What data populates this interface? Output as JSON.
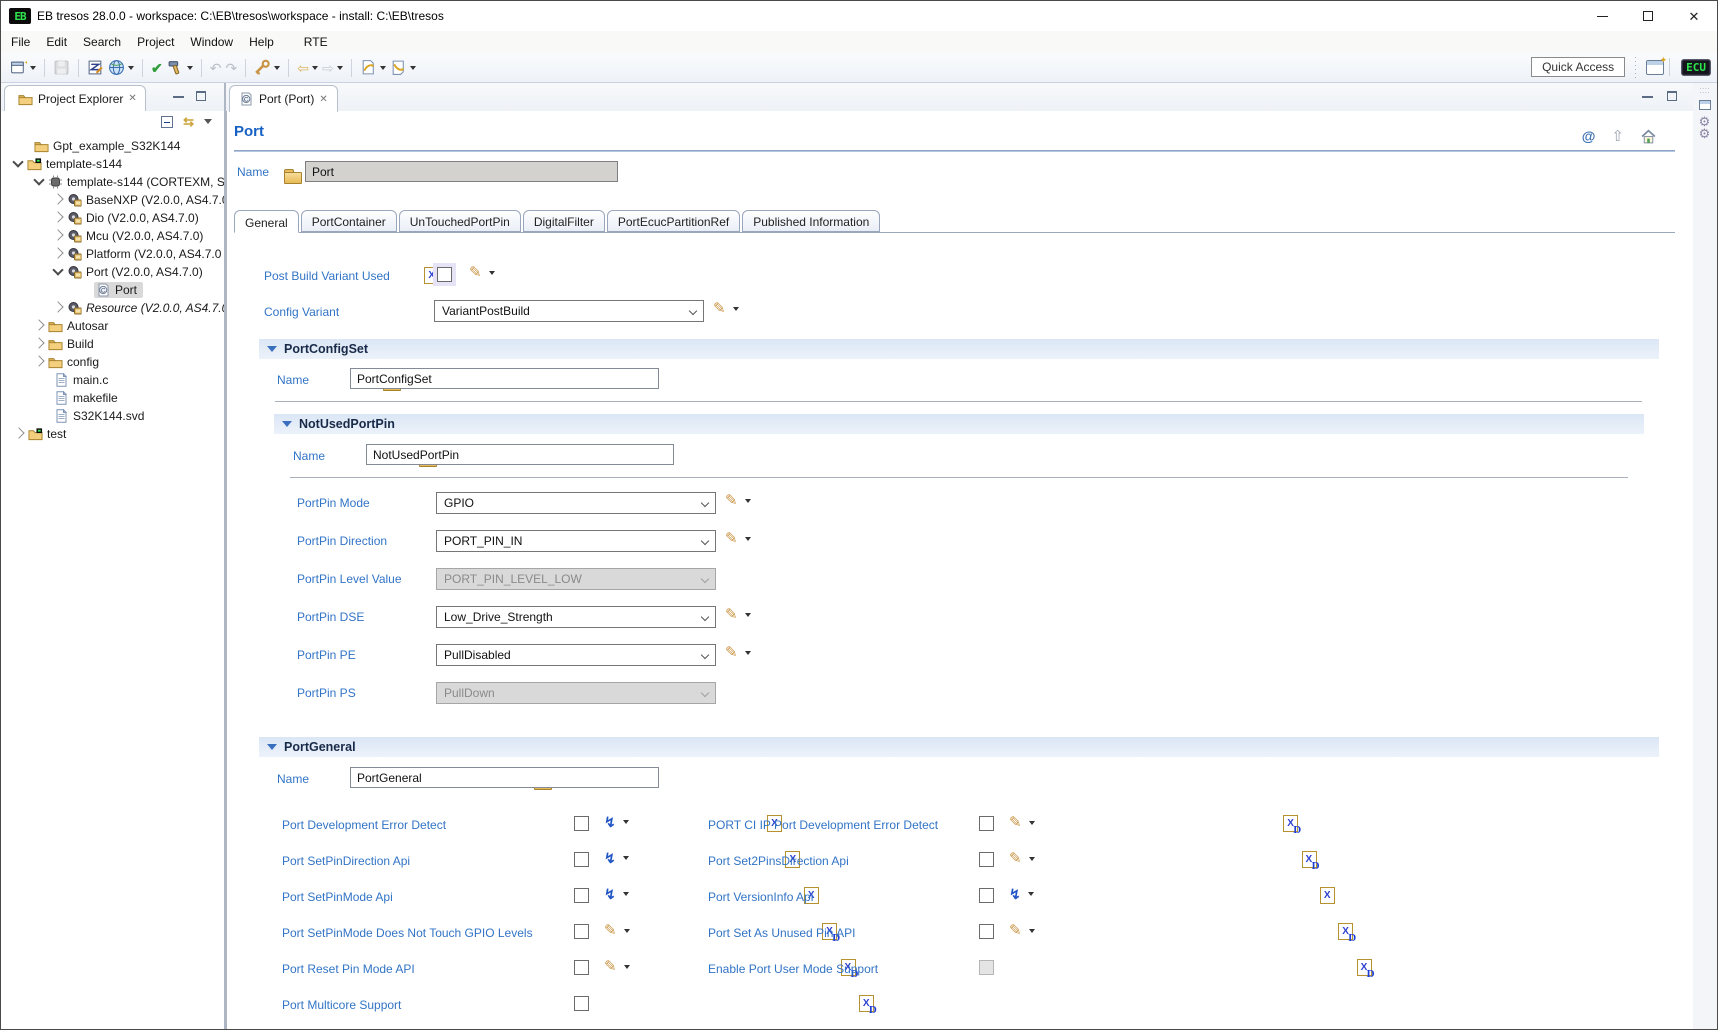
{
  "window": {
    "title": "EB tresos 28.0.0 - workspace: C:\\EB\\tresos\\workspace - install: C:\\EB\\tresos",
    "logo_text": "EB"
  },
  "menu_items": [
    "File",
    "Edit",
    "Search",
    "Project",
    "Window",
    "Help",
    "RTE"
  ],
  "toolbar": {
    "quick_access": "Quick Access",
    "perspective_label": "ECU",
    "icons": [
      "new-wizard-icon",
      "save-icon",
      "edit-config-icon",
      "generate-icon",
      "verify-icon",
      "build-icon",
      "undo-icon",
      "redo-icon",
      "code-key-icon",
      "back-icon",
      "forward-icon",
      "last-edit-icon",
      "next-annotation-icon",
      "open-perspective-icon",
      "ecu-perspective-button"
    ]
  },
  "explorer": {
    "title": "Project Explorer",
    "items": [
      {
        "label": "Gpt_example_S32K144"
      },
      {
        "label": "template-s144"
      },
      {
        "label": "template-s144 (CORTEXM, S"
      },
      {
        "label": "BaseNXP (V2.0.0, AS4.7.0"
      },
      {
        "label": "Dio (V2.0.0, AS4.7.0)"
      },
      {
        "label": "Mcu (V2.0.0, AS4.7.0)"
      },
      {
        "label": "Platform (V2.0.0, AS4.7.0"
      },
      {
        "label": "Port (V2.0.0, AS4.7.0)"
      },
      {
        "label": "Port"
      },
      {
        "label": "Resource (V2.0.0, AS4.7.0"
      },
      {
        "label": "Autosar"
      },
      {
        "label": "Build"
      },
      {
        "label": "config"
      },
      {
        "label": "main.c"
      },
      {
        "label": "makefile"
      },
      {
        "label": "S32K144.svd"
      },
      {
        "label": "test"
      }
    ]
  },
  "editor": {
    "tab_title": "Port (Port)",
    "heading": "Port",
    "name_row": {
      "label": "Name",
      "value": "Port"
    },
    "tabs": [
      "General",
      "PortContainer",
      "UnTouchedPortPin",
      "DigitalFilter",
      "PortEcucPartitionRef",
      "Published Information"
    ],
    "post_build": {
      "label": "Post Build Variant Used",
      "checked": false
    },
    "config_variant": {
      "label": "Config Variant",
      "value": "VariantPostBuild"
    },
    "port_config_set": {
      "title": "PortConfigSet",
      "name_label": "Name",
      "name_value": "PortConfigSet"
    },
    "not_used_port_pin": {
      "title": "NotUsedPortPin",
      "name_label": "Name",
      "name_value": "NotUsedPortPin",
      "rows": [
        {
          "label": "PortPin Mode",
          "value": "GPIO",
          "disabled": false
        },
        {
          "label": "PortPin Direction",
          "value": "PORT_PIN_IN",
          "disabled": false
        },
        {
          "label": "PortPin Level Value",
          "value": "PORT_PIN_LEVEL_LOW",
          "disabled": true
        },
        {
          "label": "PortPin DSE",
          "value": "Low_Drive_Strength",
          "disabled": false
        },
        {
          "label": "PortPin PE",
          "value": "PullDisabled",
          "disabled": false
        },
        {
          "label": "PortPin PS",
          "value": "PullDown",
          "disabled": true
        }
      ]
    },
    "port_general": {
      "title": "PortGeneral",
      "name_label": "Name",
      "name_value": "PortGeneral",
      "left": [
        {
          "label": "Port Development Error Detect",
          "checked": false
        },
        {
          "label": "Port SetPinDirection Api",
          "checked": false
        },
        {
          "label": "Port SetPinMode Api",
          "checked": false
        },
        {
          "label": "Port SetPinMode Does Not Touch GPIO Levels",
          "checked": false
        },
        {
          "label": "Port Reset Pin Mode API",
          "checked": false
        },
        {
          "label": "Port Multicore Support",
          "checked": false
        }
      ],
      "right": [
        {
          "label": "PORT CI IP Port Development Error Detect",
          "checked": false
        },
        {
          "label": "Port Set2PinsDirection Api",
          "checked": false
        },
        {
          "label": "Port VersionInfo Api",
          "checked": false
        },
        {
          "label": "Port Set As Unused Pin API",
          "checked": false
        },
        {
          "label": "Enable Port User Mode Support",
          "checked": false,
          "disabled": true
        }
      ]
    }
  },
  "colors": {
    "heading_blue": "#1660c4",
    "label_blue": "#3274c6",
    "section_band": "#dbe6f5",
    "ecu_green": "#2ee54e",
    "selection_gray": "#d9d9d9"
  }
}
